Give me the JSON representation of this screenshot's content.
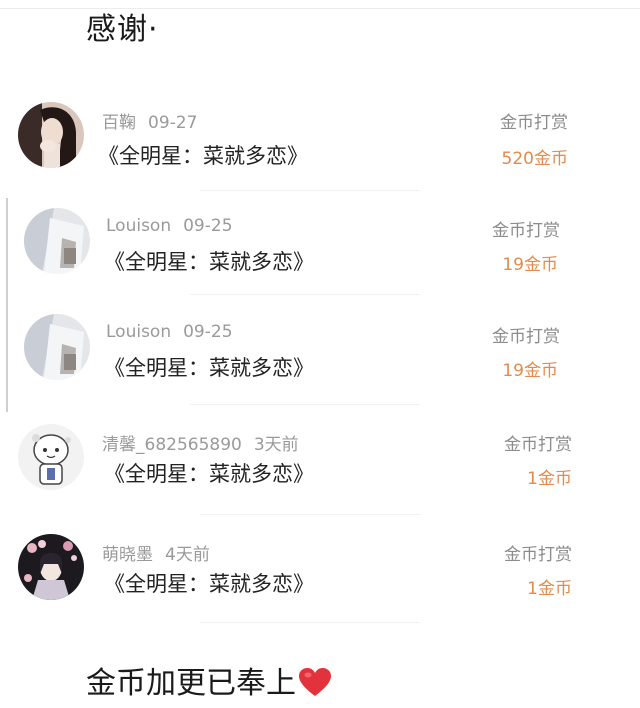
{
  "header": {
    "text": "感谢·"
  },
  "rewards": [
    {
      "name": "百鞠",
      "date": "09-27",
      "title": "《全明星：菜就多恋》",
      "action": "金币打赏",
      "amount": "520金币"
    },
    {
      "name": "Louison",
      "date": "09-25",
      "title": "《全明星：菜就多恋》",
      "action": "金币打赏",
      "amount": "19金币"
    },
    {
      "name": "Louison",
      "date": "09-25",
      "title": "《全明星：菜就多恋》",
      "action": "金币打赏",
      "amount": "19金币"
    },
    {
      "name": "清馨_682565890",
      "date": "3天前",
      "title": "《全明星：菜就多恋》",
      "action": "金币打赏",
      "amount": "1金币"
    },
    {
      "name": "萌晓墨",
      "date": "4天前",
      "title": "《全明星：菜就多恋》",
      "action": "金币打赏",
      "amount": "1金币"
    }
  ],
  "footer": {
    "text": "金币加更已奉上",
    "emoji": "heart-icon"
  },
  "colors": {
    "amount": "#e38b4d",
    "meta": "#9a9a9a",
    "heart": "#e2323c"
  }
}
